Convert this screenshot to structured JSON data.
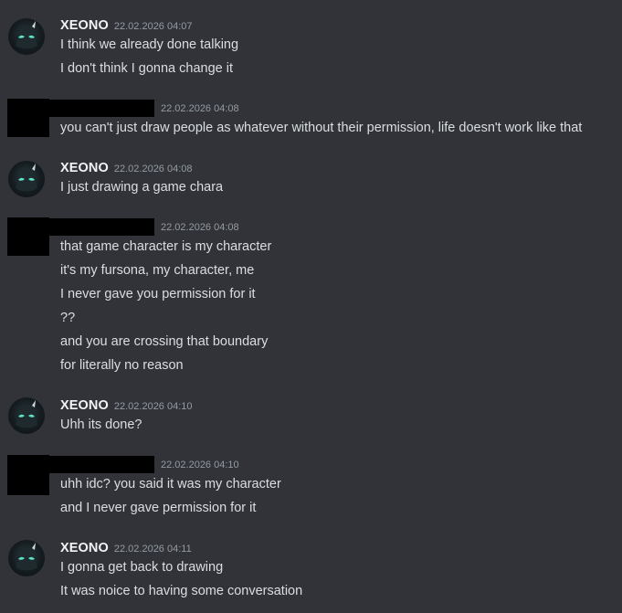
{
  "messages": [
    {
      "author": "XEONO",
      "timestamp": "22.02.2026 04:07",
      "lines": [
        "I think we already done talking",
        "I don't think I gonna change it"
      ]
    },
    {
      "author": "",
      "timestamp": "22.02.2026 04:08",
      "lines": [
        "you can't just draw people as whatever without their permission, life doesn't work like that"
      ]
    },
    {
      "author": "XEONO",
      "timestamp": "22.02.2026 04:08",
      "lines": [
        "I just drawing a game chara"
      ]
    },
    {
      "author": "",
      "timestamp": "22.02.2026 04:08",
      "lines": [
        "that game character is my character",
        "it's my fursona, my character, me",
        "I never gave you permission for it",
        "??",
        "and you are crossing that boundary",
        "for literally no reason"
      ]
    },
    {
      "author": "XEONO",
      "timestamp": "22.02.2026 04:10",
      "lines": [
        "Uhh its done?"
      ]
    },
    {
      "author": "",
      "timestamp": "22.02.2026 04:10",
      "lines": [
        "uhh idc? you said it was my character",
        "and I never gave permission for it"
      ]
    },
    {
      "author": "XEONO",
      "timestamp": "22.02.2026 04:11",
      "lines": [
        "I gonna get back to drawing",
        "It was noice to having some conversation"
      ]
    }
  ],
  "colors": {
    "background": "#313338",
    "text": "#dbdee1",
    "username": "#f2f3f5",
    "timestamp": "#949ba4",
    "redaction": "#000000",
    "avatar_eye": "#5fe3c8"
  },
  "icons": {
    "xeono_avatar": "dark-creature-avatar-icon"
  }
}
